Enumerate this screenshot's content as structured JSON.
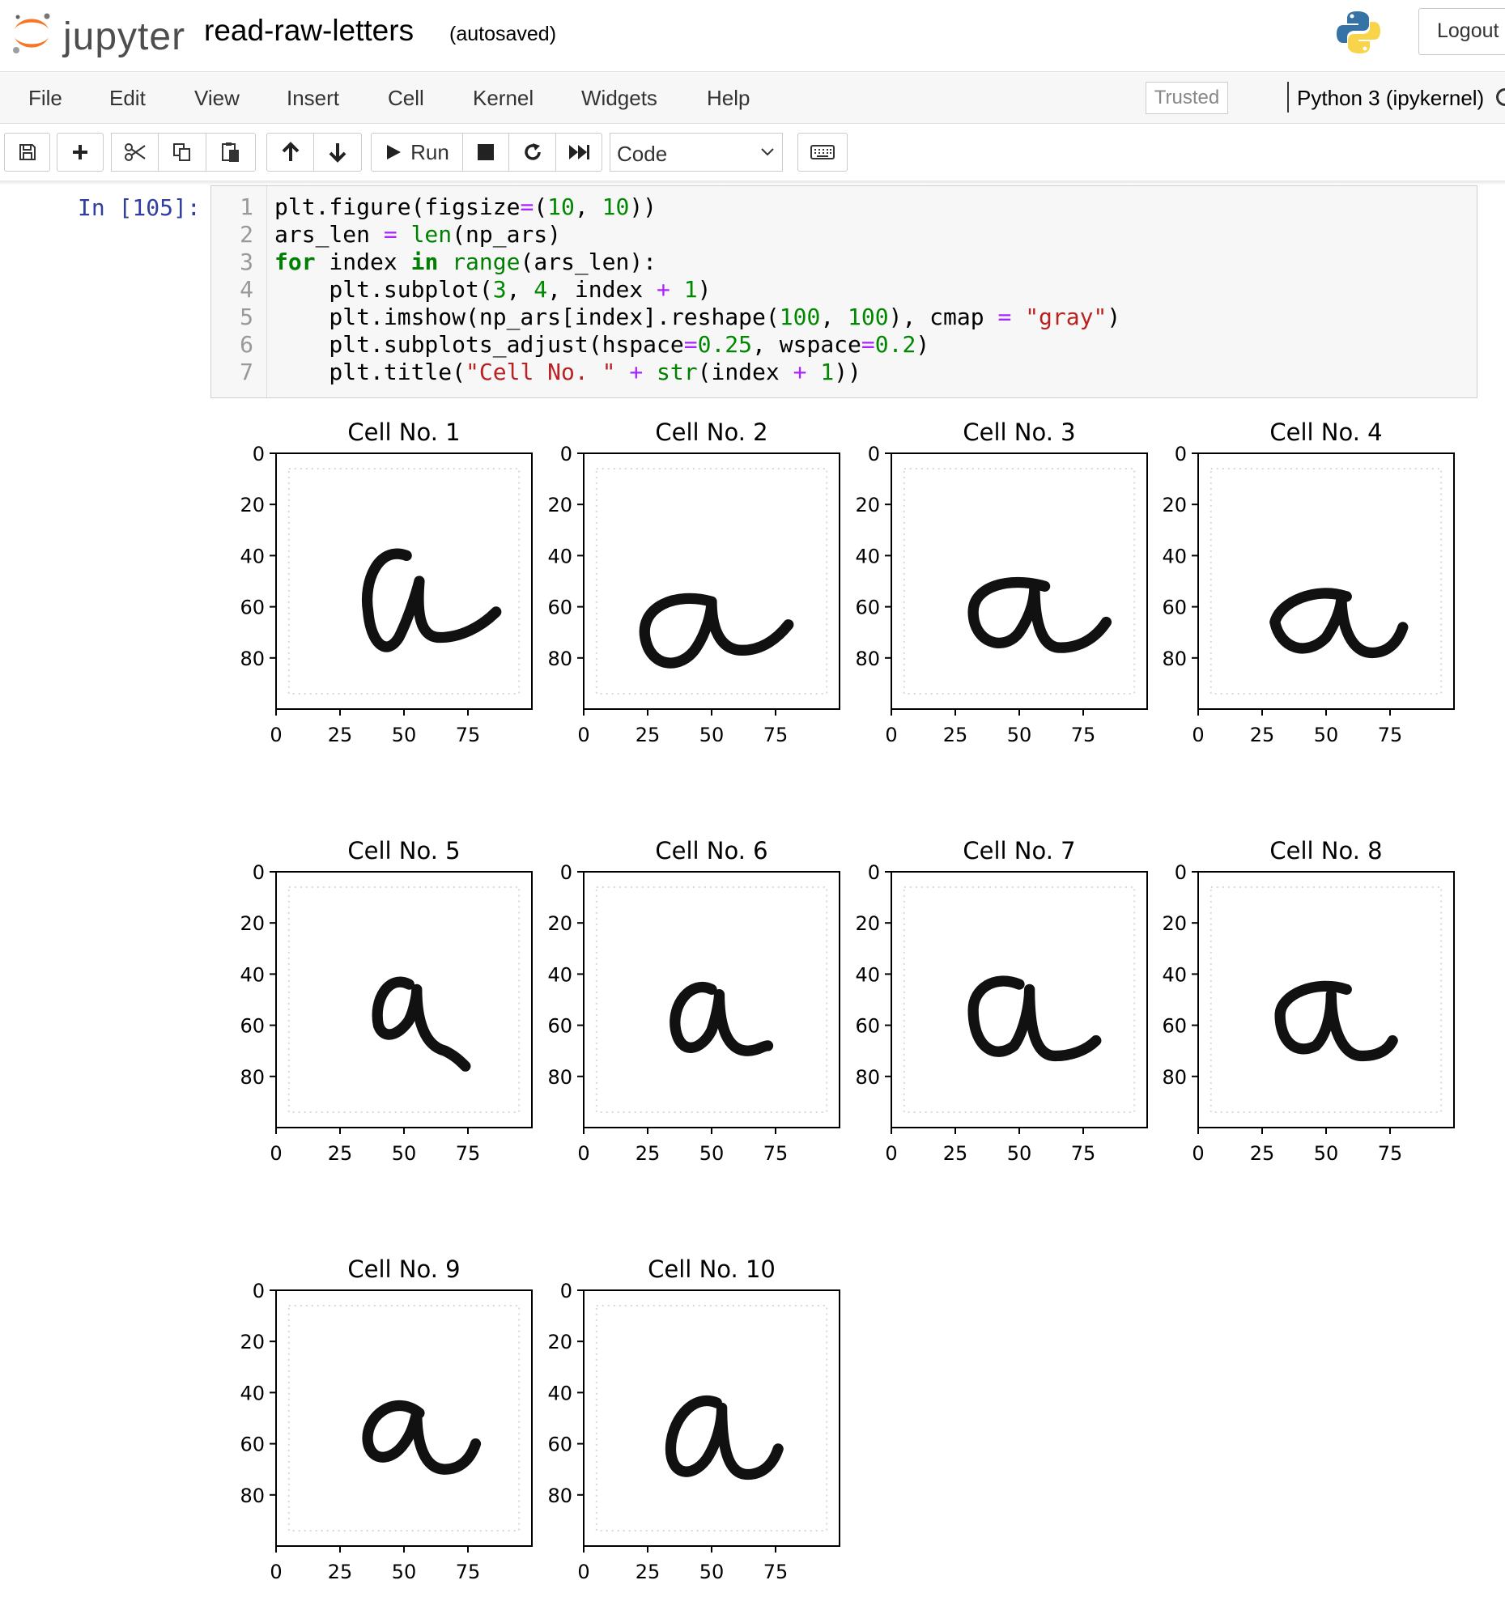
{
  "header": {
    "logo_text": "jupyter",
    "notebook_name": "read-raw-letters",
    "autosave_status": "(autosaved)",
    "logout_label": "Logout"
  },
  "menubar": {
    "items": [
      "File",
      "Edit",
      "View",
      "Insert",
      "Cell",
      "Kernel",
      "Widgets",
      "Help"
    ],
    "trusted_label": "Trusted",
    "kernel_name": "Python 3 (ipykernel)"
  },
  "toolbar": {
    "run_label": "Run",
    "cell_type": "Code",
    "icons": [
      "save-icon",
      "plus-icon",
      "scissors-icon",
      "copy-icon",
      "paste-icon",
      "arrow-up-icon",
      "arrow-down-icon",
      "play-icon",
      "stop-icon",
      "restart-icon",
      "fast-forward-icon",
      "keyboard-icon"
    ]
  },
  "cell": {
    "prompt": "In [105]:",
    "line_numbers": [
      "1",
      "2",
      "3",
      "4",
      "5",
      "6",
      "7"
    ],
    "code_lines": [
      "plt.figure(figsize=(10, 10))",
      "ars_len = len(np_ars)",
      "for index in range(ars_len):",
      "    plt.subplot(3, 4, index + 1)",
      "    plt.imshow(np_ars[index].reshape(100, 100), cmap = \"gray\")",
      "    plt.subplots_adjust(hspace=0.25, wspace=0.2)",
      "    plt.title(\"Cell No. \" + str(index + 1))"
    ]
  },
  "chart_data": {
    "type": "image-grid",
    "grid": [
      3,
      4
    ],
    "image_shape": [
      100,
      100
    ],
    "cmap": "gray",
    "content": "handwritten letter a",
    "xlim": [
      0,
      100
    ],
    "ylim": [
      100,
      0
    ],
    "xticks": [
      "0",
      "25",
      "50",
      "75"
    ],
    "yticks": [
      "0",
      "20",
      "40",
      "60",
      "80"
    ],
    "titles": [
      "Cell No. 1",
      "Cell No. 2",
      "Cell No. 3",
      "Cell No. 4",
      "Cell No. 5",
      "Cell No. 6",
      "Cell No. 7",
      "Cell No. 8",
      "Cell No. 9",
      "Cell No. 10"
    ]
  },
  "colors": {
    "prompt": "#303f9f",
    "keyword": "#008000",
    "number": "#008800",
    "operator": "#aa22ff",
    "string": "#ba2121",
    "jupyter_orange": "#f37726"
  }
}
